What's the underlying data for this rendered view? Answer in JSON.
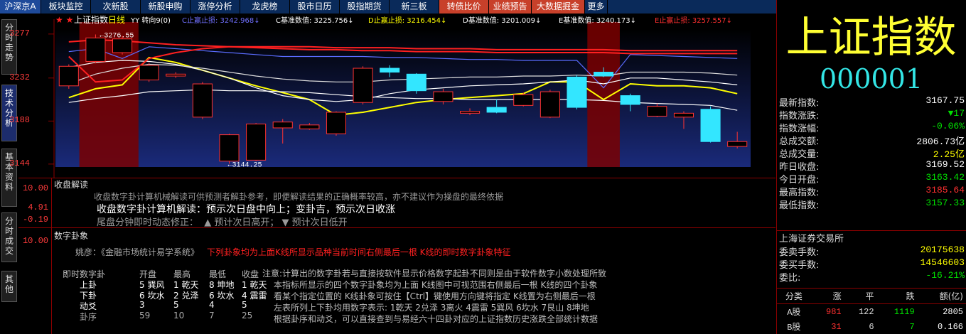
{
  "tabs": [
    "沪深京A",
    "板块监控",
    "次新股",
    "新股申购",
    "涨停分析",
    "龙虎榜",
    "股市日历",
    "股指期货",
    "新三板",
    "转债比价",
    "业绩预告",
    "大数据掘金",
    "更多"
  ],
  "side_tabs": [
    "分时走势",
    "技术分析",
    "基本资料",
    "分时成交",
    "其他"
  ],
  "chart": {
    "title": "上证指数日线",
    "extra": "YY 转向9(0)",
    "indicators": [
      {
        "label": "C止赢止损:",
        "value": "3242.968",
        "color": "#7070ff"
      },
      {
        "label": "C基准数值:",
        "value": "3225.756",
        "color": "#ffffff"
      },
      {
        "label": "D止赢止损:",
        "value": "3216.454",
        "color": "#ffff00"
      },
      {
        "label": "D基准数值:",
        "value": "3201.009",
        "color": "#ffffff"
      },
      {
        "label": "E基准数值:",
        "value": "3240.173",
        "color": "#ffffff"
      },
      {
        "label": "E止赢止损:",
        "value": "3257.557",
        "color": "#ff3030"
      }
    ],
    "high_label": "3276.55",
    "low_label": "3144.25",
    "y_ticks": [
      "3277",
      "3232",
      "3188",
      "3144"
    ]
  },
  "chart_data": {
    "type": "candlestick",
    "ylim": [
      3141,
      3282
    ],
    "candles": [
      {
        "o": 3224,
        "c": 3244,
        "h": 3246,
        "l": 3221
      },
      {
        "o": 3249,
        "c": 3273,
        "h": 3276.55,
        "l": 3247
      },
      {
        "o": 3258,
        "c": 3272,
        "h": 3275,
        "l": 3256
      },
      {
        "o": 3230,
        "c": 3245,
        "h": 3248,
        "l": 3228
      },
      {
        "o": 3234,
        "c": 3236,
        "h": 3238,
        "l": 3232
      },
      {
        "o": 3192,
        "c": 3226,
        "h": 3228,
        "l": 3190
      },
      {
        "o": 3147,
        "c": 3174,
        "h": 3175,
        "l": 3144.25
      },
      {
        "o": 3148,
        "c": 3185,
        "h": 3186,
        "l": 3147
      },
      {
        "o": 3181,
        "c": 3187,
        "h": 3190,
        "l": 3165
      },
      {
        "o": 3180,
        "c": 3184,
        "h": 3186,
        "l": 3179
      },
      {
        "o": 3175,
        "c": 3197,
        "h": 3198,
        "l": 3173
      },
      {
        "o": 3207,
        "c": 3242,
        "h": 3244,
        "l": 3205
      },
      {
        "o": 3242,
        "c": 3238,
        "h": 3245,
        "l": 3233
      },
      {
        "o": 3236,
        "c": 3219,
        "h": 3237,
        "l": 3216
      },
      {
        "o": 3208,
        "c": 3218,
        "h": 3221,
        "l": 3205
      },
      {
        "o": 3196,
        "c": 3198,
        "h": 3201,
        "l": 3194
      },
      {
        "o": 3202,
        "c": 3197,
        "h": 3210,
        "l": 3196
      },
      {
        "o": 3204,
        "c": 3215,
        "h": 3217,
        "l": 3203
      },
      {
        "o": 3192,
        "c": 3218,
        "h": 3220,
        "l": 3191
      },
      {
        "o": 3233,
        "c": 3202,
        "h": 3235,
        "l": 3200
      },
      {
        "o": 3238,
        "c": 3234,
        "h": 3243,
        "l": 3233
      },
      {
        "o": 3214,
        "c": 3205,
        "h": 3216,
        "l": 3198
      },
      {
        "o": 3193,
        "c": 3203,
        "h": 3206,
        "l": 3192
      },
      {
        "o": 3192,
        "c": 3196,
        "h": 3198,
        "l": 3180
      },
      {
        "o": 3200,
        "c": 3167,
        "h": 3203,
        "l": 3166
      },
      {
        "o": 3162,
        "c": 3167,
        "h": 3177,
        "l": 3160
      }
    ],
    "lines": [
      {
        "name": "C",
        "color": "#5a6cff",
        "values": [
          3259,
          3262,
          3252,
          3264,
          3262,
          3260,
          3258,
          3256,
          3254,
          3254,
          3254,
          3254,
          3253,
          3253,
          3252,
          3251,
          3251,
          3250,
          3250,
          3250,
          3222,
          3256,
          3255,
          3254,
          3253,
          3252
        ]
      },
      {
        "name": "D",
        "color": "#ffff00",
        "values": [
          3212,
          3221,
          3225,
          3253,
          3248,
          3240,
          3232,
          3224,
          3217,
          3210,
          3194,
          3197,
          3202,
          3207,
          3210,
          3212,
          3214,
          3216,
          3228,
          3228,
          3210,
          3226,
          3224,
          3224,
          3222,
          3216
        ]
      },
      {
        "name": "E",
        "color": "#ff2020",
        "values": [
          3269,
          3271,
          3270,
          3268,
          3266,
          3265,
          3264,
          3263,
          3262,
          3261,
          3261,
          3260,
          3260,
          3259,
          3259,
          3259,
          3258,
          3258,
          3258,
          3258,
          3258,
          3257,
          3257,
          3257,
          3257,
          3257
        ]
      },
      {
        "name": "W1",
        "color": "#ffffff",
        "values": [
          3243,
          3248,
          3250,
          3249,
          3246,
          3240,
          3232,
          3222,
          3214,
          3210,
          3208,
          3210,
          3216,
          3220,
          3222,
          3224,
          3225,
          3226,
          3228,
          3230,
          3226,
          3232,
          3232,
          3230,
          3228,
          3225
        ]
      },
      {
        "name": "W2",
        "color": "#dddddd",
        "values": [
          3226,
          3236,
          3242,
          3246,
          3245,
          3242,
          3238,
          3234,
          3231,
          3229,
          3228,
          3228,
          3230,
          3231,
          3232,
          3233,
          3233,
          3234,
          3234,
          3235,
          3234,
          3238,
          3238,
          3238,
          3237,
          3235
        ]
      },
      {
        "name": "W3",
        "color": "#ffffff",
        "values": [
          3207,
          3211,
          3214,
          3218,
          3219,
          3220,
          3219,
          3219,
          3218,
          3217,
          3215,
          3213,
          3212,
          3211,
          3211,
          3210,
          3210,
          3210,
          3210,
          3210,
          3209,
          3207,
          3206,
          3205,
          3204,
          3199
        ]
      },
      {
        "name": "R",
        "color": "#ff2020",
        "values": [
          3254,
          3228,
          3230,
          3252,
          3258,
          3262,
          3264,
          3264,
          3264,
          3264,
          3263,
          3263,
          3263,
          3262,
          3262,
          3262,
          3261,
          3261,
          3261,
          3261,
          3261,
          3260,
          3260,
          3260,
          3260,
          3260
        ]
      }
    ]
  },
  "panel2": {
    "title": "收盘解读",
    "y_ticks": [
      "10.00",
      "4.91",
      "-0.19"
    ],
    "line1": "收盘数字卦计算机械解读可供预测者解卦参考，即便解读结果的正确概率较高，亦不建议作为操盘的最终依据",
    "line2": "收盘数字卦计算机解读：预示次日盘中向上；变卦吉，预示次日收涨",
    "line3": "尾盘分钟即时动态修正：  ▲ 预计次日高开； ▼ 预计次日低开"
  },
  "panel3": {
    "title": "数字卦象",
    "y_tick": "10.00",
    "author": "姚彦：《金融市场统计易学系统》",
    "red_note": "下列卦象均为上面K线所显示品种当前时间右侧最后一根 K线的即时数字卦象特征",
    "headers": [
      "即时数字卦",
      "开盘",
      "最高",
      "最低",
      "收盘"
    ],
    "rows": [
      [
        "上卦",
        "5 巽风",
        "1 乾天",
        "8 坤地",
        "1 乾天"
      ],
      [
        "下卦",
        "6 坎水",
        "2 兑泽",
        "6 坎水",
        "4 震雷"
      ],
      [
        "动爻",
        "3",
        "5",
        "4",
        "5"
      ],
      [
        "卦序",
        "59",
        "10",
        "7",
        "25"
      ]
    ],
    "notes": [
      "注意:计算出的数字卦若与直接按软件显示价格数字起卦不同则是由于软件数字小数处理所致",
      "本指标所显示的四个数字卦象均为上面 K线图中可视范围右侧最后一根 K线的四个卦象",
      "看某个指定位置的 K线卦象可按住【Ctrl】键使用方向键将指定 K线置为右侧最后一根",
      "左表所列上下卦均用数字表示: 1乾天 2兑泽 3离火 4震雷 5巽风 6坎水 7艮山 8坤地",
      "根据卦序和动爻，可以直接查到与易经六十四卦对应的上证指数历史涨跌全部统计数据"
    ]
  },
  "quote": {
    "name": "上证指数",
    "code": "000001",
    "rows": [
      {
        "label": "最新指数:",
        "value": "3167.75",
        "color": "#ffffff"
      },
      {
        "label": "指数涨跌:",
        "value": "▼17",
        "color": "#00e000"
      },
      {
        "label": "指数涨幅:",
        "value": "-0.06%",
        "color": "#00e000"
      },
      {
        "label": "总成交额:",
        "value": "2806.73亿",
        "color": "#ffffff"
      },
      {
        "label": "总成交量:",
        "value": "2.25亿",
        "color": "#ffff00"
      },
      {
        "label": "昨日收盘:",
        "value": "3169.52",
        "color": "#ffffff"
      },
      {
        "label": "今日开盘:",
        "value": "3163.42",
        "color": "#00e000"
      },
      {
        "label": "最高指数:",
        "value": "3185.64",
        "color": "#ff3030"
      },
      {
        "label": "最低指数:",
        "value": "3157.33",
        "color": "#00e000"
      }
    ],
    "exchange": "上海证券交易所",
    "rows2": [
      {
        "label": "委卖手数:",
        "value": "20175638",
        "color": "#ffff00"
      },
      {
        "label": "委买手数:",
        "value": "14546603",
        "color": "#ffff00"
      },
      {
        "label": "委比:",
        "value": "-16.21%",
        "color": "#00e000"
      }
    ],
    "table_headers": [
      "分类",
      "涨",
      "平",
      "跌",
      "额(亿)"
    ],
    "table_rows": [
      [
        "A股",
        "981",
        "122",
        "1119",
        "2805"
      ],
      [
        "B股",
        "31",
        "6",
        "7",
        "0.166"
      ]
    ]
  }
}
